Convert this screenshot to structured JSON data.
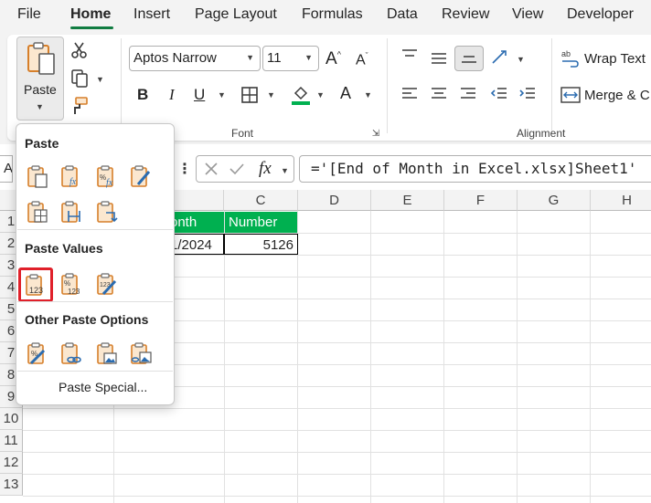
{
  "menu": {
    "items": [
      "File",
      "Home",
      "Insert",
      "Page Layout",
      "Formulas",
      "Data",
      "Review",
      "View",
      "Developer"
    ],
    "active": "Home"
  },
  "clipboard": {
    "paste_label": "Paste"
  },
  "font": {
    "name": "Aptos Narrow",
    "size": "11",
    "group_label": "Font",
    "bold": "B",
    "italic": "I",
    "underline": "U",
    "grow": "A",
    "shrink": "A",
    "font_color": "A"
  },
  "alignment": {
    "group_label": "Alignment",
    "wrap_text": "Wrap Text",
    "merge": "Merge & C"
  },
  "formula_bar": {
    "name_box": "A",
    "fx": "fx",
    "formula": "='[End of Month in Excel.xlsx]Sheet1'"
  },
  "grid": {
    "columns": [
      "C",
      "D",
      "E",
      "F",
      "G",
      "H"
    ],
    "rows": [
      "1",
      "2",
      "3",
      "4",
      "5",
      "6",
      "7",
      "8",
      "9",
      "10",
      "11",
      "12",
      "13"
    ],
    "cells": {
      "b1": "onth",
      "c1": "Number",
      "b2": "1/2024",
      "c2": "5126"
    }
  },
  "paste_menu": {
    "section_paste": "Paste",
    "section_values": "Paste Values",
    "section_other": "Other Paste Options",
    "special": "Paste Special...",
    "selected_option": "paste-values-number-formatting"
  },
  "colors": {
    "accent": "#107c41",
    "header_fill": "#00b050",
    "highlight": "#e0202a",
    "icon_orange": "#d67f2a",
    "icon_blue": "#2b6cb0"
  }
}
